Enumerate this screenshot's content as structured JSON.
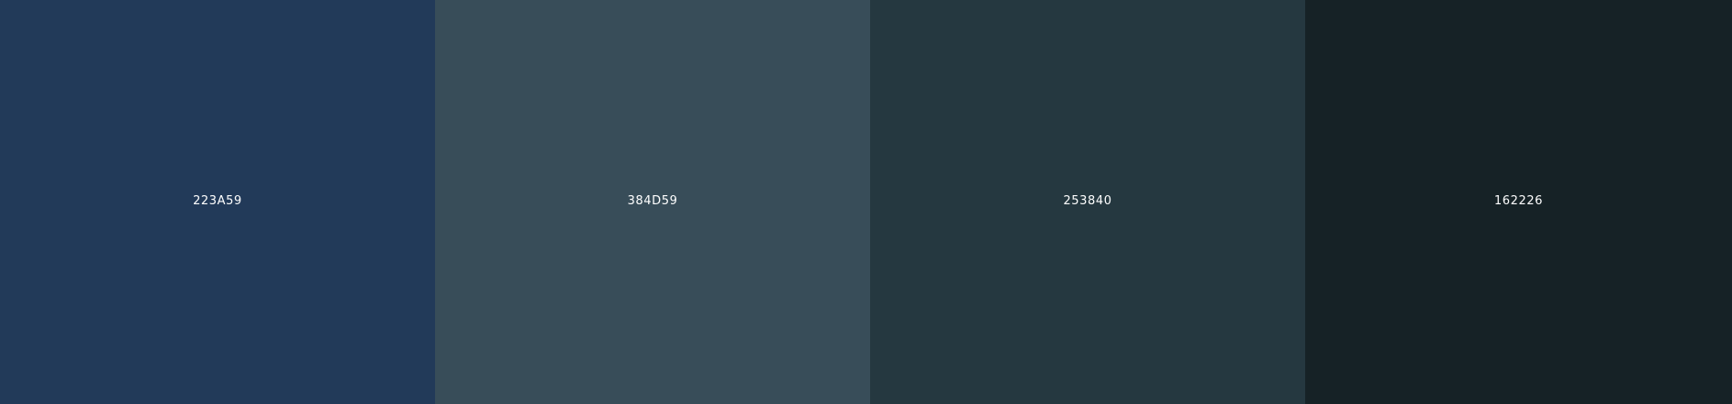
{
  "palette": {
    "swatches": [
      {
        "hex": "223A59",
        "color": "#223A59"
      },
      {
        "hex": "384D59",
        "color": "#384D59"
      },
      {
        "hex": "253840",
        "color": "#253840"
      },
      {
        "hex": "162226",
        "color": "#162226"
      }
    ],
    "label_color": "#FFFFFF"
  }
}
